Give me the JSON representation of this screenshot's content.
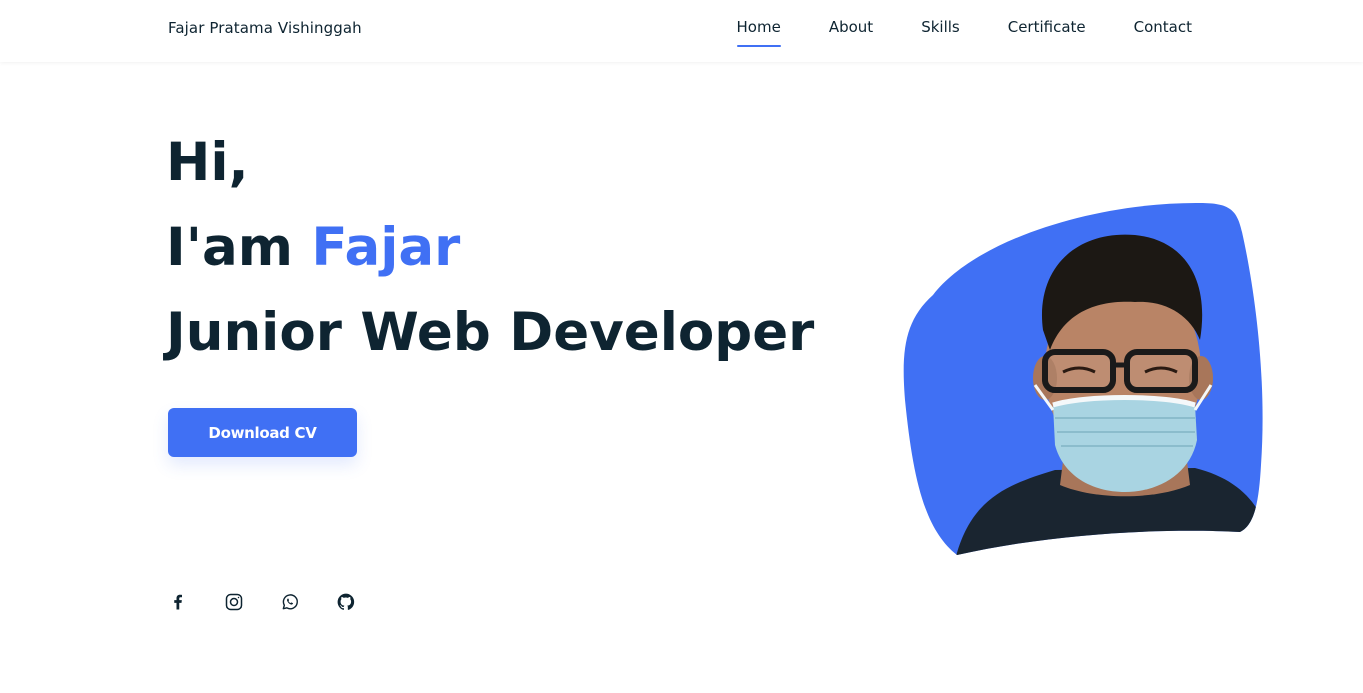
{
  "header": {
    "logo": "Fajar Pratama Vishinggah",
    "nav": [
      {
        "label": "Home",
        "active": true
      },
      {
        "label": "About",
        "active": false
      },
      {
        "label": "Skills",
        "active": false
      },
      {
        "label": "Certificate",
        "active": false
      },
      {
        "label": "Contact",
        "active": false
      }
    ]
  },
  "hero": {
    "greeting": "Hi,",
    "intro_prefix": "I'am ",
    "intro_name": "Fajar",
    "role": "Junior Web Developer",
    "cv_button": "Download CV"
  },
  "socials": [
    {
      "icon": "facebook-icon"
    },
    {
      "icon": "instagram-icon"
    },
    {
      "icon": "whatsapp-icon"
    },
    {
      "icon": "github-icon"
    }
  ],
  "colors": {
    "accent": "#4070f4",
    "text": "#0e2431",
    "background": "#ffffff"
  }
}
